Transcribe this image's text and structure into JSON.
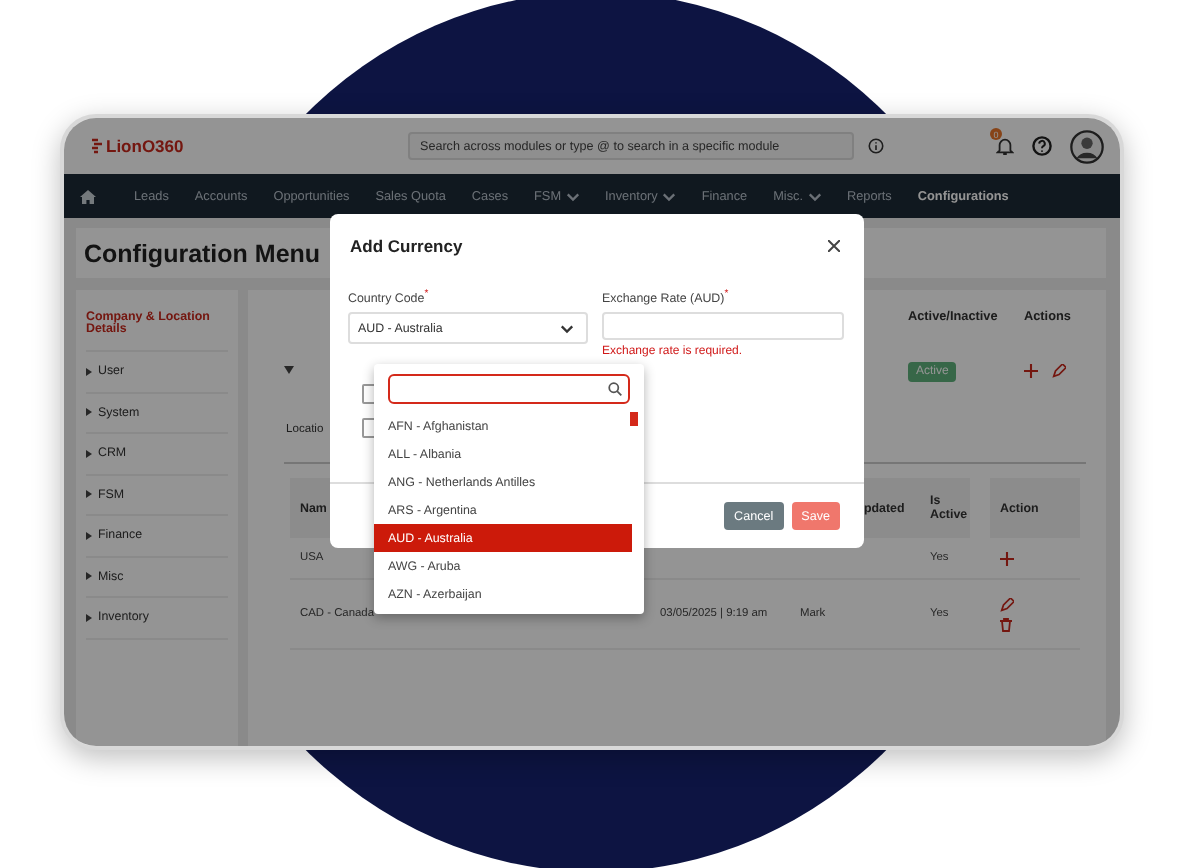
{
  "header": {
    "logo": "LionO360",
    "search": {
      "placeholder": "Search across modules or type @ to search in a specific module"
    },
    "notification_badge": "0"
  },
  "nav": [
    {
      "label": "Leads",
      "selected": false,
      "dropdown": false
    },
    {
      "label": "Accounts",
      "selected": false,
      "dropdown": false
    },
    {
      "label": "Opportunities",
      "selected": false,
      "dropdown": false
    },
    {
      "label": "Sales Quota",
      "selected": false,
      "dropdown": false
    },
    {
      "label": "Cases",
      "selected": false,
      "dropdown": false
    },
    {
      "label": "FSM",
      "selected": false,
      "dropdown": true
    },
    {
      "label": "Inventory",
      "selected": false,
      "dropdown": true
    },
    {
      "label": "Finance",
      "selected": false,
      "dropdown": false
    },
    {
      "label": "Misc.",
      "selected": false,
      "dropdown": true
    },
    {
      "label": "Reports",
      "selected": false,
      "dropdown": false
    },
    {
      "label": "Configurations",
      "selected": true,
      "dropdown": false
    }
  ],
  "page_title": "Configuration Menu",
  "sidebar": {
    "items": [
      {
        "label": "Company & Location Details",
        "selected": true
      },
      {
        "label": "User",
        "selected": false
      },
      {
        "label": "System",
        "selected": false
      },
      {
        "label": "CRM",
        "selected": false
      },
      {
        "label": "FSM",
        "selected": false
      },
      {
        "label": "Finance",
        "selected": false
      },
      {
        "label": "Misc",
        "selected": false
      },
      {
        "label": "Inventory",
        "selected": false
      }
    ]
  },
  "panel": {
    "columns": {
      "status": "Active/Inactive",
      "actions": "Actions"
    },
    "row": {
      "status": "Active",
      "actions": [
        {
          "kind": "add"
        },
        {
          "kind": "edit"
        }
      ]
    },
    "tab": "Locatio"
  },
  "table": {
    "columns": {
      "name": "Nam",
      "updated": "pdated",
      "is_active": "Is Active",
      "action": "Action"
    },
    "rows": [
      {
        "name": "USA",
        "is_active": "Yes",
        "actions": [
          {
            "kind": "add"
          }
        ]
      },
      {
        "name": "CAD - Canada",
        "date": "03/05/2025 | 9:19 am",
        "updated_by": "Mark",
        "is_active": "Yes",
        "actions": [
          {
            "kind": "edit"
          },
          {
            "kind": "delete"
          }
        ]
      }
    ]
  },
  "modal": {
    "title": "Add Currency",
    "fields": [
      {
        "kind": "select",
        "label": "Country Code$^{*}$",
        "value": "AUD - Australia"
      },
      {
        "kind": "input",
        "label": "Exchange Rate (AUD)$^{*}$",
        "error": "Exchange rate is required."
      }
    ],
    "checkboxes": [
      {
        "checked": false
      },
      {
        "checked": false
      }
    ],
    "buttons": [
      {
        "kind": "secondary",
        "label": "Cancel"
      },
      {
        "kind": "primary",
        "label": "Save"
      }
    ]
  },
  "dropdown": {
    "items": [
      {
        "label": "AFN - Afghanistan",
        "selected": false
      },
      {
        "label": "ALL - Albania",
        "selected": false
      },
      {
        "label": "ANG - Netherlands Antilles",
        "selected": false
      },
      {
        "label": "ARS - Argentina",
        "selected": false
      },
      {
        "label": "AUD - Australia",
        "selected": true
      },
      {
        "label": "AWG - Aruba",
        "selected": false
      },
      {
        "label": "AZN - Azerbaijan",
        "selected": false
      }
    ]
  }
}
